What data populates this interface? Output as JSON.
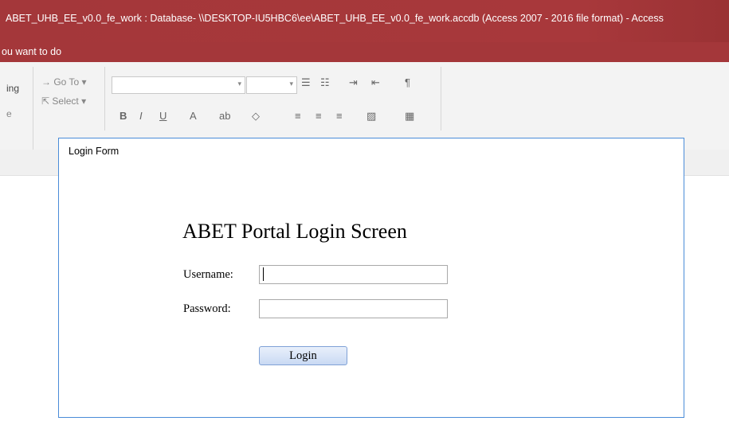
{
  "window": {
    "title": "ABET_UHB_EE_v0.0_fe_work : Database- \\\\DESKTOP-IU5HBC6\\ee\\ABET_UHB_EE_v0.0_fe_work.accdb (Access 2007 - 2016 file format)  -  Access"
  },
  "tell_me": {
    "text": "ou want to do"
  },
  "ribbon": {
    "partial_label_1": "ing",
    "partial_label_2": "e",
    "goto_label": "→ Go To ▾",
    "select_label": "Select ▾",
    "font_name_value": "",
    "font_size_value": "",
    "bold": "B",
    "italic": "I",
    "underline": "U",
    "font_color": "A",
    "highlight": "ab",
    "fill": "◇",
    "bullets": "☰",
    "numbering": "☷",
    "indent_increase": "⇥",
    "indent_decrease": "⇤",
    "rtl": "¶",
    "align_left": "≡",
    "align_center": "≡",
    "align_right": "≡",
    "alt_fill": "▨",
    "gridlines": "▦"
  },
  "login_form": {
    "window_title": "Login Form",
    "heading": "ABET Portal Login Screen",
    "username_label": "Username:",
    "username_value": "",
    "password_label": "Password:",
    "password_value": "",
    "login_button": "Login"
  }
}
